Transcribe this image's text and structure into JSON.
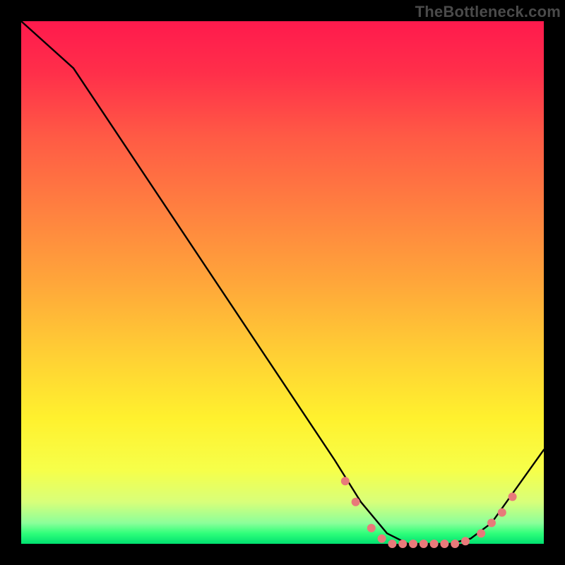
{
  "watermark": "TheBottleneck.com",
  "chart_data": {
    "type": "line",
    "title": "",
    "xlabel": "",
    "ylabel": "",
    "xlim": [
      0,
      100
    ],
    "ylim": [
      0,
      100
    ],
    "grid": false,
    "legend": false,
    "series": [
      {
        "name": "bottleneck-curve",
        "color": "#000000",
        "x": [
          0,
          10,
          20,
          30,
          40,
          50,
          60,
          65,
          70,
          74,
          78,
          82,
          86,
          90,
          100
        ],
        "y": [
          100,
          91,
          76,
          61,
          46,
          31,
          16,
          8,
          2,
          0,
          0,
          0,
          1,
          4,
          18
        ]
      }
    ],
    "markers": {
      "name": "bottleneck-markers",
      "color": "#e87a7a",
      "radius": 6,
      "points": [
        {
          "x": 62,
          "y": 12
        },
        {
          "x": 64,
          "y": 8
        },
        {
          "x": 67,
          "y": 3
        },
        {
          "x": 69,
          "y": 1
        },
        {
          "x": 71,
          "y": 0
        },
        {
          "x": 73,
          "y": 0
        },
        {
          "x": 75,
          "y": 0
        },
        {
          "x": 77,
          "y": 0
        },
        {
          "x": 79,
          "y": 0
        },
        {
          "x": 81,
          "y": 0
        },
        {
          "x": 83,
          "y": 0
        },
        {
          "x": 85,
          "y": 0.5
        },
        {
          "x": 88,
          "y": 2
        },
        {
          "x": 90,
          "y": 4
        },
        {
          "x": 92,
          "y": 6
        },
        {
          "x": 94,
          "y": 9
        }
      ]
    }
  }
}
